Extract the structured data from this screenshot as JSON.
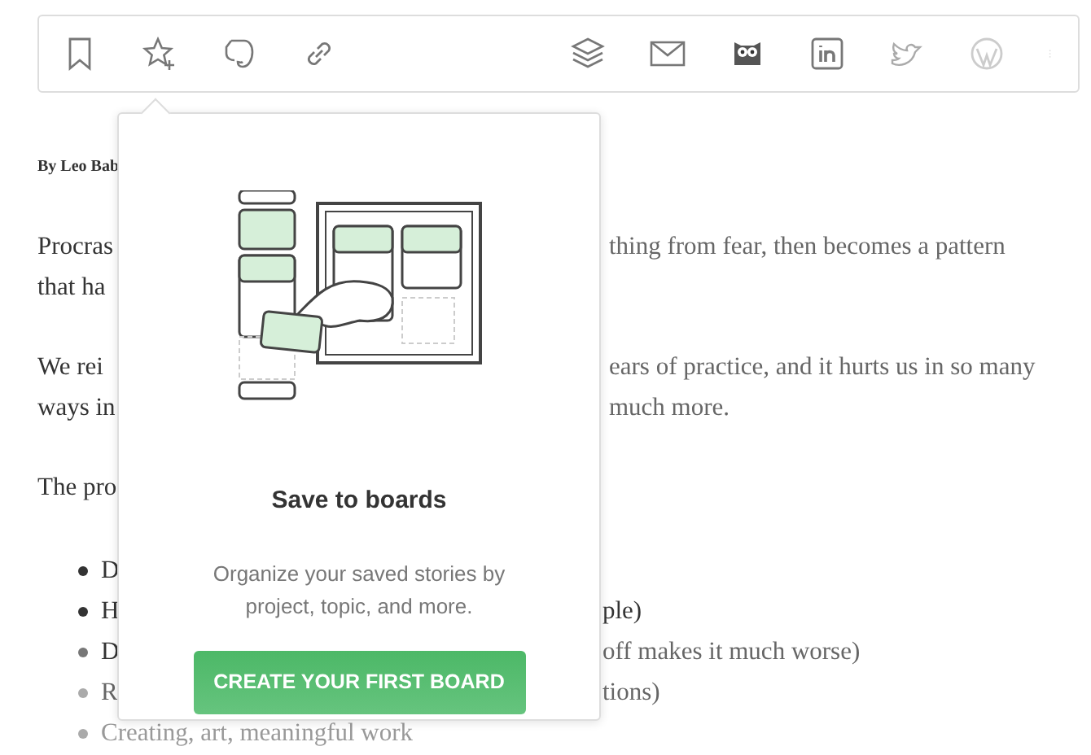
{
  "byline": "By Leo Bab",
  "paragraphs": [
    {
      "lines": [
        {
          "left": "Procras",
          "right": "thing from fear, then becomes a pattern"
        },
        {
          "left": "that ha"
        }
      ]
    },
    {
      "lines": [
        {
          "left": "We rei",
          "right": "ears of practice, and it hurts us in so many"
        },
        {
          "left": "ways in",
          "right": "much more."
        }
      ]
    },
    {
      "lines": [
        {
          "left": "The pro"
        }
      ]
    }
  ],
  "list": [
    {
      "left": "D"
    },
    {
      "left": "H",
      "right": "ple)"
    },
    {
      "left": "D",
      "right": "off makes it much worse)"
    },
    {
      "left": "R",
      "right": "tions)"
    },
    {
      "left": "Creating, art, meaningful work"
    }
  ],
  "popover": {
    "title": "Save to boards",
    "text": "Organize your saved stories by project, topic, and more.",
    "button": "CREATE YOUR FIRST BOARD"
  }
}
